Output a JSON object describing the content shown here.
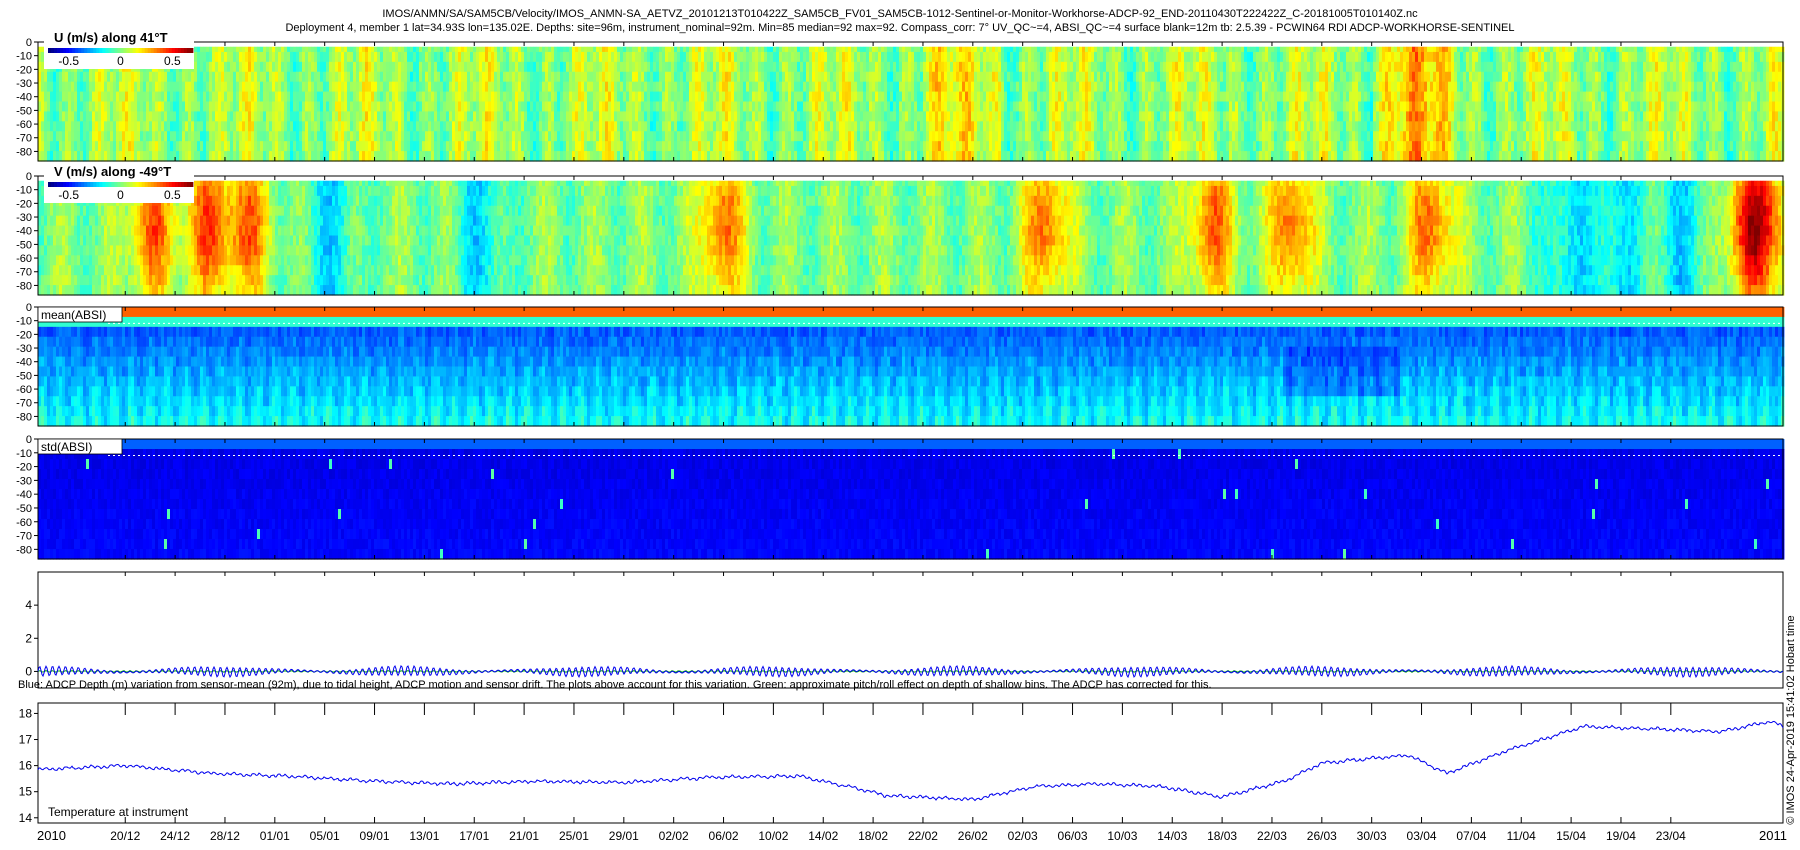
{
  "header": {
    "line1": "IMOS/ANMN/SA/SAM5CB/Velocity/IMOS_ANMN-SA_AETVZ_20101213T010422Z_SAM5CB_FV01_SAM5CB-1012-Sentinel-or-Monitor-Workhorse-ADCP-92_END-20110430T222422Z_C-20181005T010140Z.nc",
    "line2": "Deployment 4, member 1 lat=34.93S lon=135.02E. Depths: site=96m, instrument_nominal=92m. Min=85 median=92 max=92. Compass_corr: 7° UV_QC~=4, ABSI_QC~=4 surface blank=12m tb: 2.5.39 - PCWIN64 RDI ADCP-WORKHORSE-SENTINEL"
  },
  "side_label": "© IMOS 24-Apr-2019 15:41:02 Hobart time",
  "colors": {
    "line_blue": "#0000ee",
    "line_green": "#00aa00",
    "jet_low": "#00008f",
    "jet_high": "#800000"
  },
  "chart_data": [
    {
      "type": "heatmap",
      "panel": "u",
      "label": "U (m/s) along 41°T",
      "yticks": [
        0,
        -10,
        -20,
        -30,
        -40,
        -50,
        -60,
        -70,
        -80
      ],
      "ylim": [
        -87,
        0
      ],
      "colorbar": {
        "ticks": [
          "-0.5",
          "0",
          "0.5"
        ],
        "range": [
          -0.7,
          0.7
        ],
        "colormap": "jet"
      }
    },
    {
      "type": "heatmap",
      "panel": "v",
      "label": "V (m/s) along -49°T",
      "yticks": [
        0,
        -10,
        -20,
        -30,
        -40,
        -50,
        -60,
        -70,
        -80
      ],
      "ylim": [
        -87,
        0
      ],
      "colorbar": {
        "ticks": [
          "-0.5",
          "0",
          "0.5"
        ],
        "range": [
          -0.7,
          0.7
        ],
        "colormap": "jet"
      }
    },
    {
      "type": "heatmap",
      "panel": "mean_absi",
      "label": "mean(ABSI)",
      "yticks": [
        0,
        -10,
        -20,
        -30,
        -40,
        -50,
        -60,
        -70,
        -80
      ],
      "ylim": [
        -87,
        0
      ],
      "colormap": "jet"
    },
    {
      "type": "heatmap",
      "panel": "std_absi",
      "label": "std(ABSI)",
      "yticks": [
        0,
        -10,
        -20,
        -30,
        -40,
        -50,
        -60,
        -70,
        -80
      ],
      "ylim": [
        -87,
        0
      ],
      "colormap": "jet"
    },
    {
      "type": "line",
      "panel": "depth",
      "label": "Blue: ADCP Depth (m) variation from sensor-mean (92m), due to tidal height, ADCP motion and sensor drift. The plots above account for this variation. Green: approximate pitch/roll effect on depth of shallow bins. The ADCP has corrected for this.",
      "yticks": [
        0,
        2,
        4
      ],
      "ylim": [
        -1,
        6
      ],
      "series": [
        {
          "color": "#0000ee",
          "tidal_amplitude_m": 0.35,
          "mean_m": 0
        },
        {
          "color": "#00aa00",
          "tidal_amplitude_m": 0.05,
          "mean_m": 0
        }
      ]
    },
    {
      "type": "line",
      "panel": "temperature",
      "label": "Temperature at instrument",
      "yticks": [
        14,
        15,
        16,
        17,
        18
      ],
      "ylim": [
        13.8,
        18.4
      ],
      "x_days": [
        0,
        7,
        14,
        20,
        27,
        33,
        40,
        47,
        54,
        61,
        66,
        68,
        75,
        80,
        85,
        90,
        95,
        100,
        103,
        110,
        113,
        118,
        124,
        130,
        135,
        139,
        140
      ],
      "temperature": [
        15.85,
        16.0,
        15.7,
        15.6,
        15.4,
        15.3,
        15.4,
        15.35,
        15.55,
        15.6,
        15.1,
        14.85,
        14.7,
        15.2,
        15.3,
        15.2,
        14.8,
        15.4,
        16.1,
        16.4,
        15.7,
        16.6,
        17.5,
        17.4,
        17.3,
        17.7,
        17.5
      ]
    }
  ],
  "x_axis": {
    "start_day": 0,
    "end_day": 140,
    "year_start_label": "2010",
    "year_end_label": "2011",
    "ticks": [
      {
        "day": 7,
        "label": "20/12"
      },
      {
        "day": 11,
        "label": "24/12"
      },
      {
        "day": 15,
        "label": "28/12"
      },
      {
        "day": 19,
        "label": "01/01"
      },
      {
        "day": 23,
        "label": "05/01"
      },
      {
        "day": 27,
        "label": "09/01"
      },
      {
        "day": 31,
        "label": "13/01"
      },
      {
        "day": 35,
        "label": "17/01"
      },
      {
        "day": 39,
        "label": "21/01"
      },
      {
        "day": 43,
        "label": "25/01"
      },
      {
        "day": 47,
        "label": "29/01"
      },
      {
        "day": 51,
        "label": "02/02"
      },
      {
        "day": 55,
        "label": "06/02"
      },
      {
        "day": 59,
        "label": "10/02"
      },
      {
        "day": 63,
        "label": "14/02"
      },
      {
        "day": 67,
        "label": "18/02"
      },
      {
        "day": 71,
        "label": "22/02"
      },
      {
        "day": 75,
        "label": "26/02"
      },
      {
        "day": 79,
        "label": "02/03"
      },
      {
        "day": 83,
        "label": "06/03"
      },
      {
        "day": 87,
        "label": "10/03"
      },
      {
        "day": 91,
        "label": "14/03"
      },
      {
        "day": 95,
        "label": "18/03"
      },
      {
        "day": 99,
        "label": "22/03"
      },
      {
        "day": 103,
        "label": "26/03"
      },
      {
        "day": 107,
        "label": "30/03"
      },
      {
        "day": 111,
        "label": "03/04"
      },
      {
        "day": 115,
        "label": "07/04"
      },
      {
        "day": 119,
        "label": "11/04"
      },
      {
        "day": 123,
        "label": "15/04"
      },
      {
        "day": 127,
        "label": "19/04"
      },
      {
        "day": 131,
        "label": "23/04"
      }
    ]
  }
}
